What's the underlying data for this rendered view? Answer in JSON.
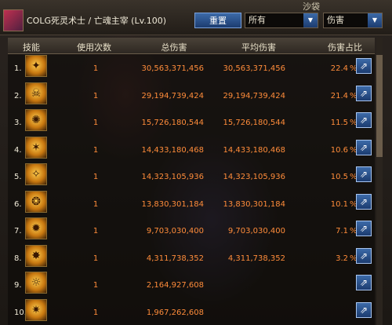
{
  "window": {
    "title": "COLG死灵术士 / 亡魂主宰 (Lv.100)",
    "background_tag": "沙袋",
    "reset_label": "重置",
    "filter_value": "所有",
    "sort_value": "伤害"
  },
  "columns": {
    "skill": "技能",
    "uses": "使用次数",
    "total": "总伤害",
    "avg": "平均伤害",
    "share": "伤害占比"
  },
  "rows": [
    {
      "rank": "1.",
      "uses": "1",
      "total": "30,563,371,456",
      "avg": "30,563,371,456",
      "pct": "22.4",
      "pct_symbol": "%"
    },
    {
      "rank": "2.",
      "uses": "1",
      "total": "29,194,739,424",
      "avg": "29,194,739,424",
      "pct": "21.4",
      "pct_symbol": "%"
    },
    {
      "rank": "3.",
      "uses": "1",
      "total": "15,726,180,544",
      "avg": "15,726,180,544",
      "pct": "11.5",
      "pct_symbol": "%"
    },
    {
      "rank": "4.",
      "uses": "1",
      "total": "14,433,180,468",
      "avg": "14,433,180,468",
      "pct": "10.6",
      "pct_symbol": "%"
    },
    {
      "rank": "5.",
      "uses": "1",
      "total": "14,323,105,936",
      "avg": "14,323,105,936",
      "pct": "10.5",
      "pct_symbol": "%"
    },
    {
      "rank": "6.",
      "uses": "1",
      "total": "13,830,301,184",
      "avg": "13,830,301,184",
      "pct": "10.1",
      "pct_symbol": "%"
    },
    {
      "rank": "7.",
      "uses": "1",
      "total": "9,703,030,400",
      "avg": "9,703,030,400",
      "pct": "7.1",
      "pct_symbol": "%"
    },
    {
      "rank": "8.",
      "uses": "1",
      "total": "4,311,738,352",
      "avg": "4,311,738,352",
      "pct": "3.2",
      "pct_symbol": "%"
    },
    {
      "rank": "9.",
      "uses": "1",
      "total": "2,164,927,608",
      "avg": "",
      "pct": "",
      "pct_symbol": ""
    },
    {
      "rank": "10.",
      "uses": "1",
      "total": "1,967,262,608",
      "avg": "",
      "pct": "",
      "pct_symbol": ""
    }
  ],
  "colors": {
    "value_text": "#ff8c3a",
    "button_blue": "#2c5596",
    "header_bg": "#3c342b"
  }
}
